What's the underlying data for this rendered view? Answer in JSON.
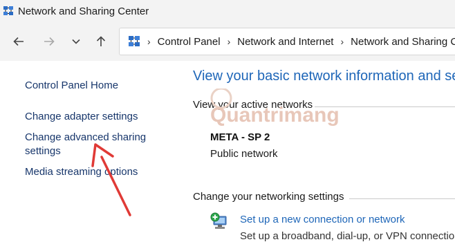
{
  "window": {
    "title": "Network and Sharing Center"
  },
  "nav": {
    "icons": [
      "back-arrow-icon",
      "forward-arrow-icon",
      "chevron-down-icon",
      "up-arrow-icon"
    ]
  },
  "address_bar": {
    "crumbs": [
      "Control Panel",
      "Network and Internet",
      "Network and Sharing C"
    ]
  },
  "sidebar": {
    "items": [
      {
        "label": "Control Panel Home"
      },
      {
        "label": "Change adapter settings"
      },
      {
        "label": "Change advanced sharing settings",
        "line1": "Change advanced sharing",
        "line2": "settings"
      },
      {
        "label": "Media streaming options"
      }
    ]
  },
  "main": {
    "title": "View your basic network information and se",
    "active_networks_heading": "View your active networks",
    "network": {
      "name": "META - SP 2",
      "type": "Public network"
    },
    "networking_settings_heading": "Change your networking settings",
    "setup": {
      "link": "Set up a new connection or network",
      "description": "Set up a broadband, dial-up, or VPN connection"
    }
  },
  "watermark": {
    "text": "Quantrimang"
  },
  "colors": {
    "link": "#1e66b8",
    "sidebar_link": "#17366b",
    "annotation_arrow": "#e03a36"
  }
}
